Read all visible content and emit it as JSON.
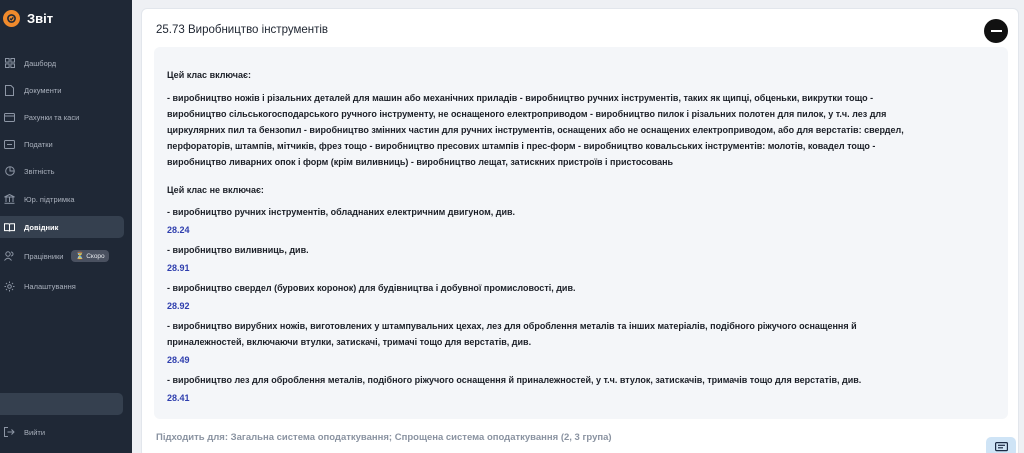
{
  "app": {
    "name": "Звіт"
  },
  "sidebar": {
    "items": [
      {
        "label": "Дашборд",
        "icon": "dashboard-icon"
      },
      {
        "label": "Документи",
        "icon": "document-icon"
      },
      {
        "label": "Рахунки та каси",
        "icon": "wallet-icon"
      },
      {
        "label": "Податки",
        "icon": "tax-icon"
      },
      {
        "label": "Звітність",
        "icon": "report-icon"
      },
      {
        "label": "Юр. підтримка",
        "icon": "legal-icon"
      },
      {
        "label": "Довідник",
        "icon": "book-icon",
        "active": true
      },
      {
        "label": "Працівники",
        "icon": "people-icon",
        "badge": "Скоро"
      },
      {
        "label": "Налаштування",
        "icon": "gear-icon"
      }
    ],
    "logout_label": "Вийти"
  },
  "card": {
    "title": "25.73 Виробництво інструментів",
    "includes_heading": "Цей клас включає:",
    "includes_lines": [
      "- виробництво ножів і різальних деталей для машин або механічних приладів - виробництво ручних інструментів, таких як щипці, обценьки, викрутки тощо -",
      "виробництво сільськогосподарського ручного інструменту, не оснащеного електроприводом - виробництво пилок і різальних полотен для пилок, у т.ч. лез для",
      "циркулярних пил та бензопил - виробництво змінних частин для ручних інструментів, оснащених або не оснащених електроприводом, або для верстатів: свердел,",
      "перфораторів, штампів, мітчиків, фрез тощо - виробництво пресових штампів і прес-форм - виробництво ковальських інструментів: молотів, ковадел тощо -",
      "виробництво ливарних опок і форм (крім виливниць) - виробництво лещат, затискних пристроїв і пристосовань"
    ],
    "excludes_heading": "Цей клас не включає:",
    "excludes": [
      {
        "lines": [
          "- виробництво ручних інструментів, обладнаних електричним двигуном, див."
        ],
        "ref": "28.24"
      },
      {
        "lines": [
          "- виробництво виливниць, див."
        ],
        "ref": "28.91"
      },
      {
        "lines": [
          "- виробництво свердел (бурових коронок) для будівництва і добувної промисловості, див."
        ],
        "ref": "28.92"
      },
      {
        "lines": [
          "- виробництво вирубних ножів, виготовлених у штампувальних цехах, лез для оброблення металів та інших матеріалів, подібного ріжучого оснащення й",
          "приналежностей, включаючи втулки, затискачі, тримачі тощо для верстатів, див."
        ],
        "ref": "28.49"
      },
      {
        "lines": [
          "- виробництво лез для оброблення металів, подібного ріжучого оснащення й приналежностей, у т.ч. втулок, затискачів, тримачів тощо для верстатів, див."
        ],
        "ref": "28.41"
      }
    ],
    "suits_text": "Підходить для: Загальна система оподаткування; Спрощена система оподаткування (2, 3 група)"
  },
  "colors": {
    "sidebar_bg": "#1f2836",
    "accent": "#f08a2c",
    "ref_link": "#2f3fae"
  }
}
